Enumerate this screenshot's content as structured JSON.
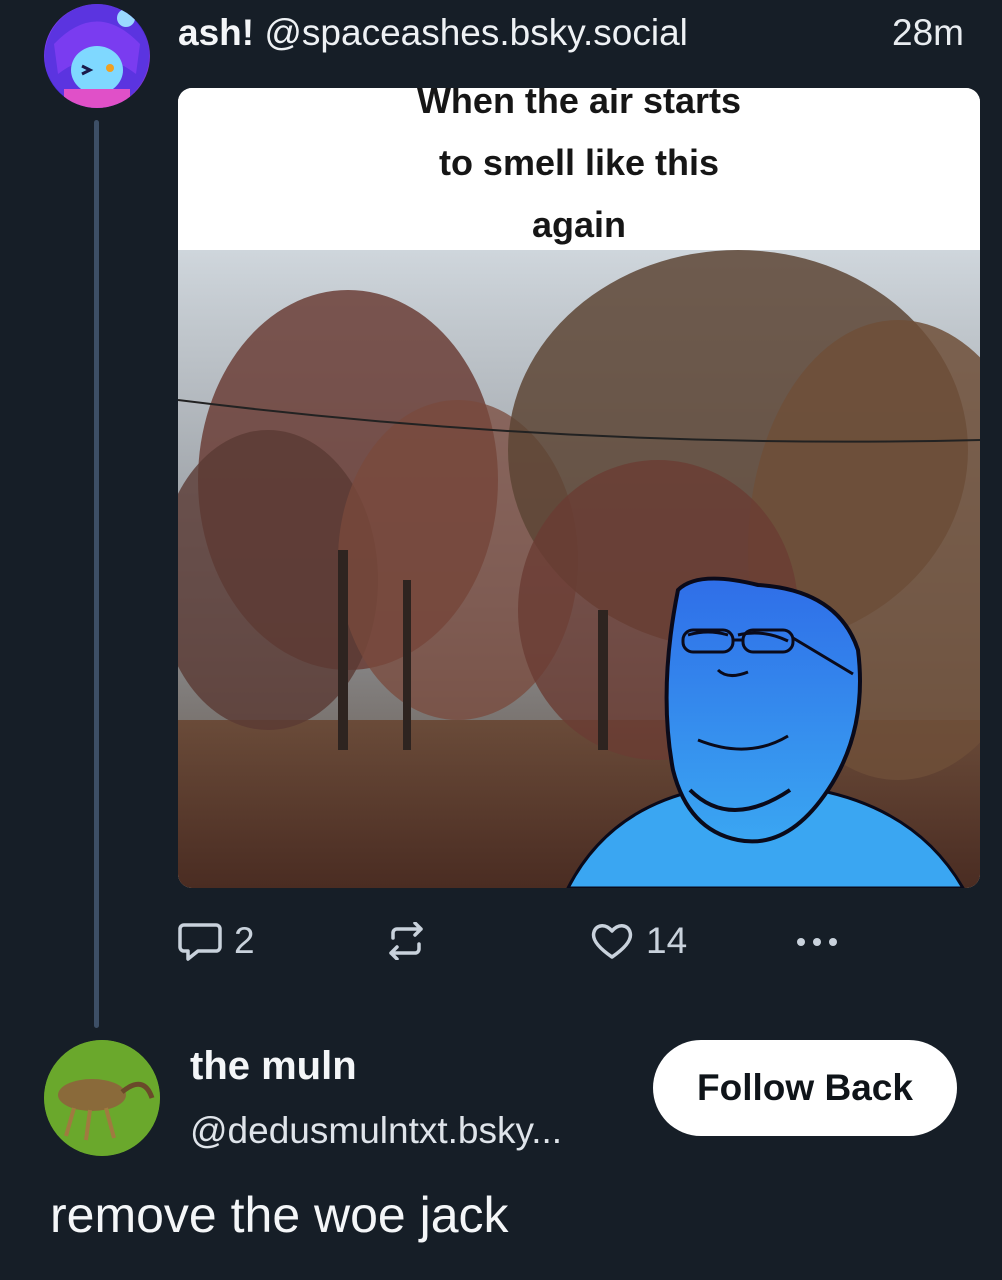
{
  "post": {
    "author_name": "ash!",
    "author_handle": "@spaceashes.bsky.social",
    "timestamp": "28m",
    "meme_caption": "When the air starts\nto smell like this\nagain",
    "reply_count": "2",
    "like_count": "14",
    "icons": {
      "reply": "speech-bubble-icon",
      "repost": "repost-arrows-icon",
      "like": "heart-icon",
      "more": "ellipsis-icon"
    }
  },
  "reply": {
    "author_name": "the muln",
    "author_handle": "@dedusmulntxt.bsky...",
    "follow_label": "Follow Back",
    "text": "remove the woe jack"
  },
  "colors": {
    "background": "#161e27",
    "thread_line": "#3d4f66",
    "icon_gray": "#c9d2dc",
    "button_bg": "#ffffff"
  }
}
